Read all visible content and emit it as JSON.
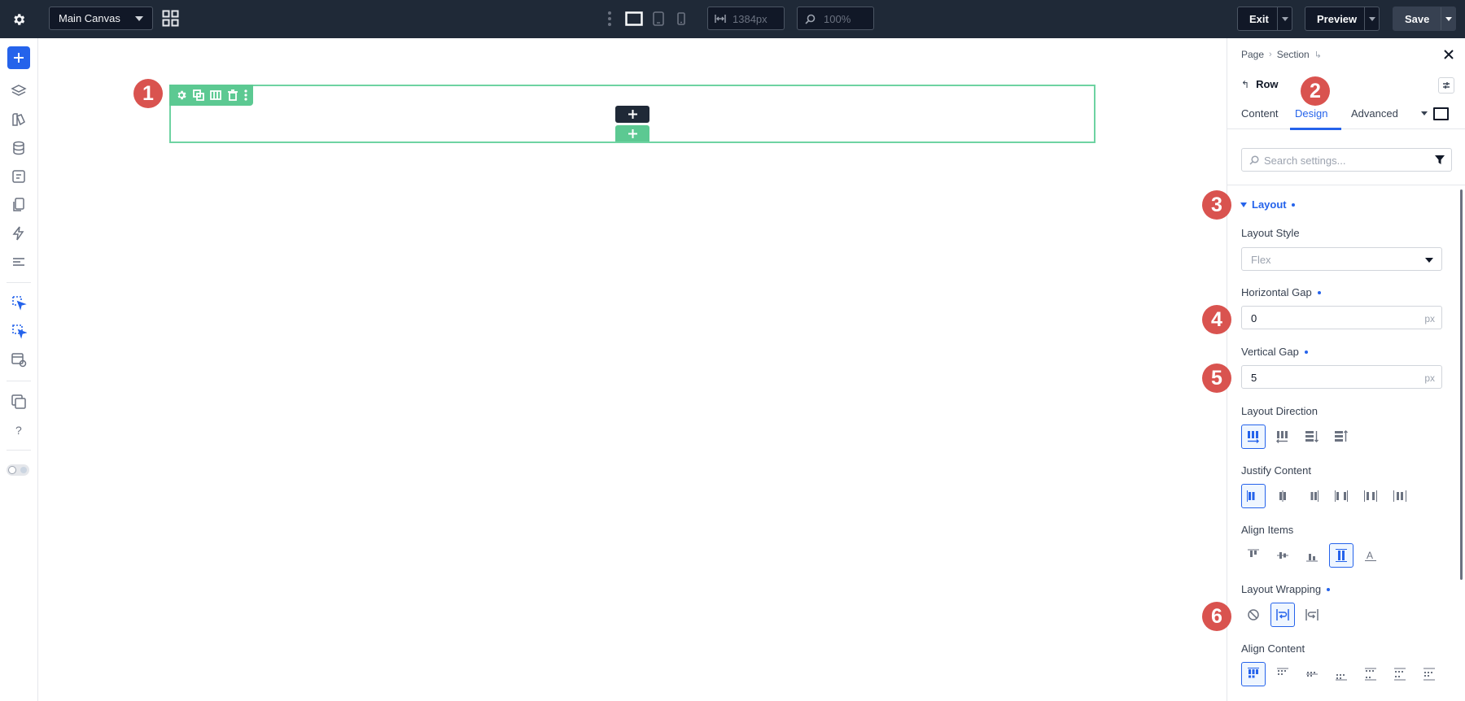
{
  "topbar": {
    "canvas_select": "Main Canvas",
    "width_value": "1384px",
    "zoom_value": "100%",
    "exit_label": "Exit",
    "preview_label": "Preview",
    "save_label": "Save"
  },
  "canvas": {
    "callouts": [
      "1",
      "2",
      "3",
      "4",
      "5",
      "6"
    ]
  },
  "panel": {
    "breadcrumb": [
      "Page",
      "Section"
    ],
    "breadcrumb_sep": "›",
    "breadcrumb_tail": "↳",
    "back_arrow": "↰",
    "back_label": "Row",
    "tabs": [
      "Content",
      "Design",
      "Advanced"
    ],
    "active_tab": "Design",
    "search_placeholder": "Search settings...",
    "group_title": "Layout",
    "layout_style_label": "Layout Style",
    "layout_style_value": "Flex",
    "horizontal_gap_label": "Horizontal Gap",
    "horizontal_gap_value": "0",
    "horizontal_gap_unit": "px",
    "vertical_gap_label": "Vertical Gap",
    "vertical_gap_value": "5",
    "vertical_gap_unit": "px",
    "layout_direction_label": "Layout Direction",
    "justify_content_label": "Justify Content",
    "align_items_label": "Align Items",
    "layout_wrapping_label": "Layout Wrapping",
    "align_content_label": "Align Content"
  },
  "colors": {
    "accent": "#2563eb",
    "row_outline": "#6ed3a2",
    "row_toolbar": "#5cc992",
    "callout": "#d9534f",
    "topbar": "#1f2937"
  }
}
